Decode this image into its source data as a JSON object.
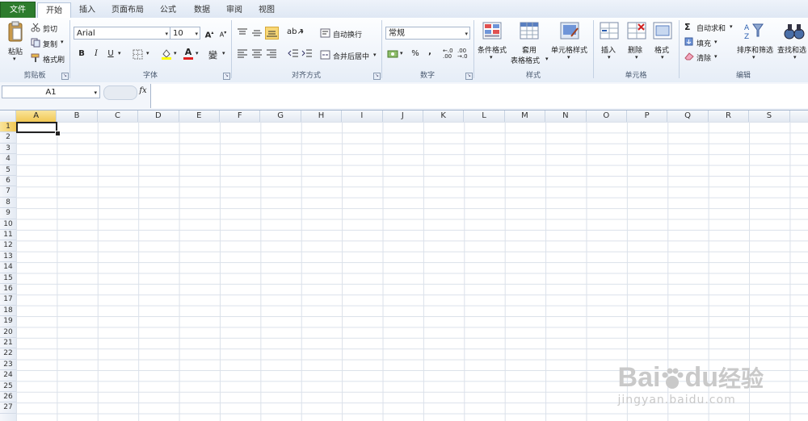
{
  "tabs": [
    "文件",
    "开始",
    "插入",
    "页面布局",
    "公式",
    "数据",
    "审阅",
    "视图"
  ],
  "active_tab": "开始",
  "clipboard": {
    "paste": "粘贴",
    "cut": "剪切",
    "copy": "复制",
    "format_painter": "格式刷",
    "label": "剪贴板"
  },
  "font": {
    "name": "Arial",
    "size": "10",
    "bold": "B",
    "italic": "I",
    "underline": "U",
    "grow": "A",
    "shrink": "A",
    "label": "字体"
  },
  "alignment": {
    "wrap": "自动换行",
    "merge": "合并后居中",
    "label": "对齐方式"
  },
  "number": {
    "format": "常规",
    "percent": "%",
    "comma": ",",
    "label": "数字"
  },
  "styles": {
    "conditional": "条件格式",
    "table1": "套用",
    "table2": "表格格式",
    "cell_styles": "单元格样式",
    "label": "样式"
  },
  "cells": {
    "insert": "插入",
    "delete": "删除",
    "format": "格式",
    "label": "单元格"
  },
  "editing": {
    "autosum": "自动求和",
    "fill": "填充",
    "clear": "清除",
    "sort": "排序和筛选",
    "find": "查找和选",
    "label": "编辑"
  },
  "formula_bar": {
    "name_box": "A1",
    "fx": "fx",
    "content": ""
  },
  "columns": [
    "A",
    "B",
    "C",
    "D",
    "E",
    "F",
    "G",
    "H",
    "I",
    "J",
    "K",
    "L",
    "M",
    "N",
    "O",
    "P",
    "Q",
    "R",
    "S"
  ],
  "rows": [
    "1",
    "2",
    "3",
    "4",
    "5",
    "6",
    "7",
    "8",
    "9",
    "10",
    "11",
    "12",
    "13",
    "14",
    "15",
    "16",
    "17",
    "18",
    "19",
    "20",
    "21",
    "22",
    "23",
    "24",
    "25",
    "26",
    "27"
  ],
  "watermark": {
    "brand": "Bai",
    "brand2": "du",
    "site_cn": "经验",
    "url": "jingyan.baidu.com"
  }
}
